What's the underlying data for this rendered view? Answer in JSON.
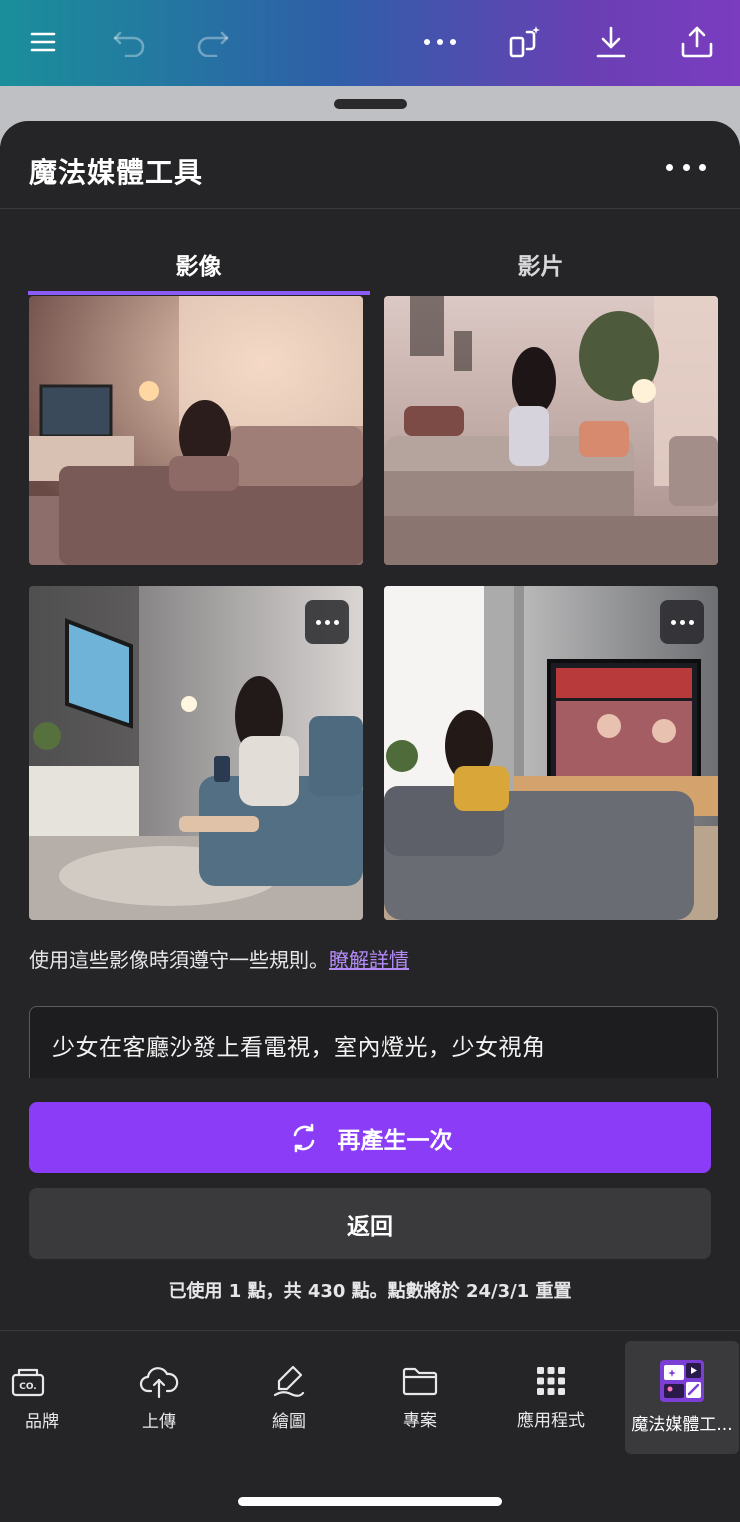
{
  "topbar": {
    "icons": [
      "menu-icon",
      "undo-icon",
      "redo-icon",
      "more-icon",
      "magic-resize-icon",
      "download-icon",
      "share-icon"
    ]
  },
  "sheet": {
    "title": "魔法媒體工具",
    "tabs": [
      {
        "label": "影像",
        "active": true
      },
      {
        "label": "影片",
        "active": false
      }
    ]
  },
  "images": [
    {
      "desc": "image-1"
    },
    {
      "desc": "image-2"
    },
    {
      "desc": "image-3"
    },
    {
      "desc": "image-4"
    }
  ],
  "rules": {
    "text": "使用這些影像時須遵守一些規則。",
    "link": "瞭解詳情"
  },
  "prompt": {
    "value": "少女在客廳沙發上看電視，室內燈光，少女視角"
  },
  "buttons": {
    "regenerate": "再產生一次",
    "back": "返回"
  },
  "credits": "已使用 1 點，共 430 點。點數將於 24/3/1 重置",
  "bottom_nav": [
    {
      "label": "品牌",
      "icon": "brand-icon"
    },
    {
      "label": "上傳",
      "icon": "upload-cloud-icon"
    },
    {
      "label": "繪圖",
      "icon": "draw-icon"
    },
    {
      "label": "專案",
      "icon": "folder-icon"
    },
    {
      "label": "應用程式",
      "icon": "apps-grid-icon"
    },
    {
      "label": "魔法媒體工...",
      "icon": "magic-media-icon",
      "selected": true
    }
  ],
  "colors": {
    "accent": "#8b3cf7",
    "tab_underline": "#8b5cf6",
    "link": "#b48af7",
    "sheet_bg": "#252527"
  }
}
